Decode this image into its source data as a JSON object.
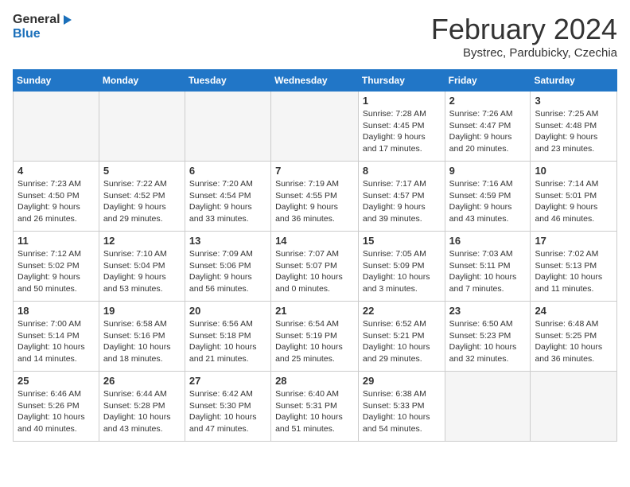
{
  "header": {
    "logo_general": "General",
    "logo_blue": "Blue",
    "month_title": "February 2024",
    "subtitle": "Bystrec, Pardubicky, Czechia"
  },
  "weekdays": [
    "Sunday",
    "Monday",
    "Tuesday",
    "Wednesday",
    "Thursday",
    "Friday",
    "Saturday"
  ],
  "weeks": [
    [
      {
        "day": "",
        "info": ""
      },
      {
        "day": "",
        "info": ""
      },
      {
        "day": "",
        "info": ""
      },
      {
        "day": "",
        "info": ""
      },
      {
        "day": "1",
        "info": "Sunrise: 7:28 AM\nSunset: 4:45 PM\nDaylight: 9 hours\nand 17 minutes."
      },
      {
        "day": "2",
        "info": "Sunrise: 7:26 AM\nSunset: 4:47 PM\nDaylight: 9 hours\nand 20 minutes."
      },
      {
        "day": "3",
        "info": "Sunrise: 7:25 AM\nSunset: 4:48 PM\nDaylight: 9 hours\nand 23 minutes."
      }
    ],
    [
      {
        "day": "4",
        "info": "Sunrise: 7:23 AM\nSunset: 4:50 PM\nDaylight: 9 hours\nand 26 minutes."
      },
      {
        "day": "5",
        "info": "Sunrise: 7:22 AM\nSunset: 4:52 PM\nDaylight: 9 hours\nand 29 minutes."
      },
      {
        "day": "6",
        "info": "Sunrise: 7:20 AM\nSunset: 4:54 PM\nDaylight: 9 hours\nand 33 minutes."
      },
      {
        "day": "7",
        "info": "Sunrise: 7:19 AM\nSunset: 4:55 PM\nDaylight: 9 hours\nand 36 minutes."
      },
      {
        "day": "8",
        "info": "Sunrise: 7:17 AM\nSunset: 4:57 PM\nDaylight: 9 hours\nand 39 minutes."
      },
      {
        "day": "9",
        "info": "Sunrise: 7:16 AM\nSunset: 4:59 PM\nDaylight: 9 hours\nand 43 minutes."
      },
      {
        "day": "10",
        "info": "Sunrise: 7:14 AM\nSunset: 5:01 PM\nDaylight: 9 hours\nand 46 minutes."
      }
    ],
    [
      {
        "day": "11",
        "info": "Sunrise: 7:12 AM\nSunset: 5:02 PM\nDaylight: 9 hours\nand 50 minutes."
      },
      {
        "day": "12",
        "info": "Sunrise: 7:10 AM\nSunset: 5:04 PM\nDaylight: 9 hours\nand 53 minutes."
      },
      {
        "day": "13",
        "info": "Sunrise: 7:09 AM\nSunset: 5:06 PM\nDaylight: 9 hours\nand 56 minutes."
      },
      {
        "day": "14",
        "info": "Sunrise: 7:07 AM\nSunset: 5:07 PM\nDaylight: 10 hours\nand 0 minutes."
      },
      {
        "day": "15",
        "info": "Sunrise: 7:05 AM\nSunset: 5:09 PM\nDaylight: 10 hours\nand 3 minutes."
      },
      {
        "day": "16",
        "info": "Sunrise: 7:03 AM\nSunset: 5:11 PM\nDaylight: 10 hours\nand 7 minutes."
      },
      {
        "day": "17",
        "info": "Sunrise: 7:02 AM\nSunset: 5:13 PM\nDaylight: 10 hours\nand 11 minutes."
      }
    ],
    [
      {
        "day": "18",
        "info": "Sunrise: 7:00 AM\nSunset: 5:14 PM\nDaylight: 10 hours\nand 14 minutes."
      },
      {
        "day": "19",
        "info": "Sunrise: 6:58 AM\nSunset: 5:16 PM\nDaylight: 10 hours\nand 18 minutes."
      },
      {
        "day": "20",
        "info": "Sunrise: 6:56 AM\nSunset: 5:18 PM\nDaylight: 10 hours\nand 21 minutes."
      },
      {
        "day": "21",
        "info": "Sunrise: 6:54 AM\nSunset: 5:19 PM\nDaylight: 10 hours\nand 25 minutes."
      },
      {
        "day": "22",
        "info": "Sunrise: 6:52 AM\nSunset: 5:21 PM\nDaylight: 10 hours\nand 29 minutes."
      },
      {
        "day": "23",
        "info": "Sunrise: 6:50 AM\nSunset: 5:23 PM\nDaylight: 10 hours\nand 32 minutes."
      },
      {
        "day": "24",
        "info": "Sunrise: 6:48 AM\nSunset: 5:25 PM\nDaylight: 10 hours\nand 36 minutes."
      }
    ],
    [
      {
        "day": "25",
        "info": "Sunrise: 6:46 AM\nSunset: 5:26 PM\nDaylight: 10 hours\nand 40 minutes."
      },
      {
        "day": "26",
        "info": "Sunrise: 6:44 AM\nSunset: 5:28 PM\nDaylight: 10 hours\nand 43 minutes."
      },
      {
        "day": "27",
        "info": "Sunrise: 6:42 AM\nSunset: 5:30 PM\nDaylight: 10 hours\nand 47 minutes."
      },
      {
        "day": "28",
        "info": "Sunrise: 6:40 AM\nSunset: 5:31 PM\nDaylight: 10 hours\nand 51 minutes."
      },
      {
        "day": "29",
        "info": "Sunrise: 6:38 AM\nSunset: 5:33 PM\nDaylight: 10 hours\nand 54 minutes."
      },
      {
        "day": "",
        "info": ""
      },
      {
        "day": "",
        "info": ""
      }
    ]
  ]
}
